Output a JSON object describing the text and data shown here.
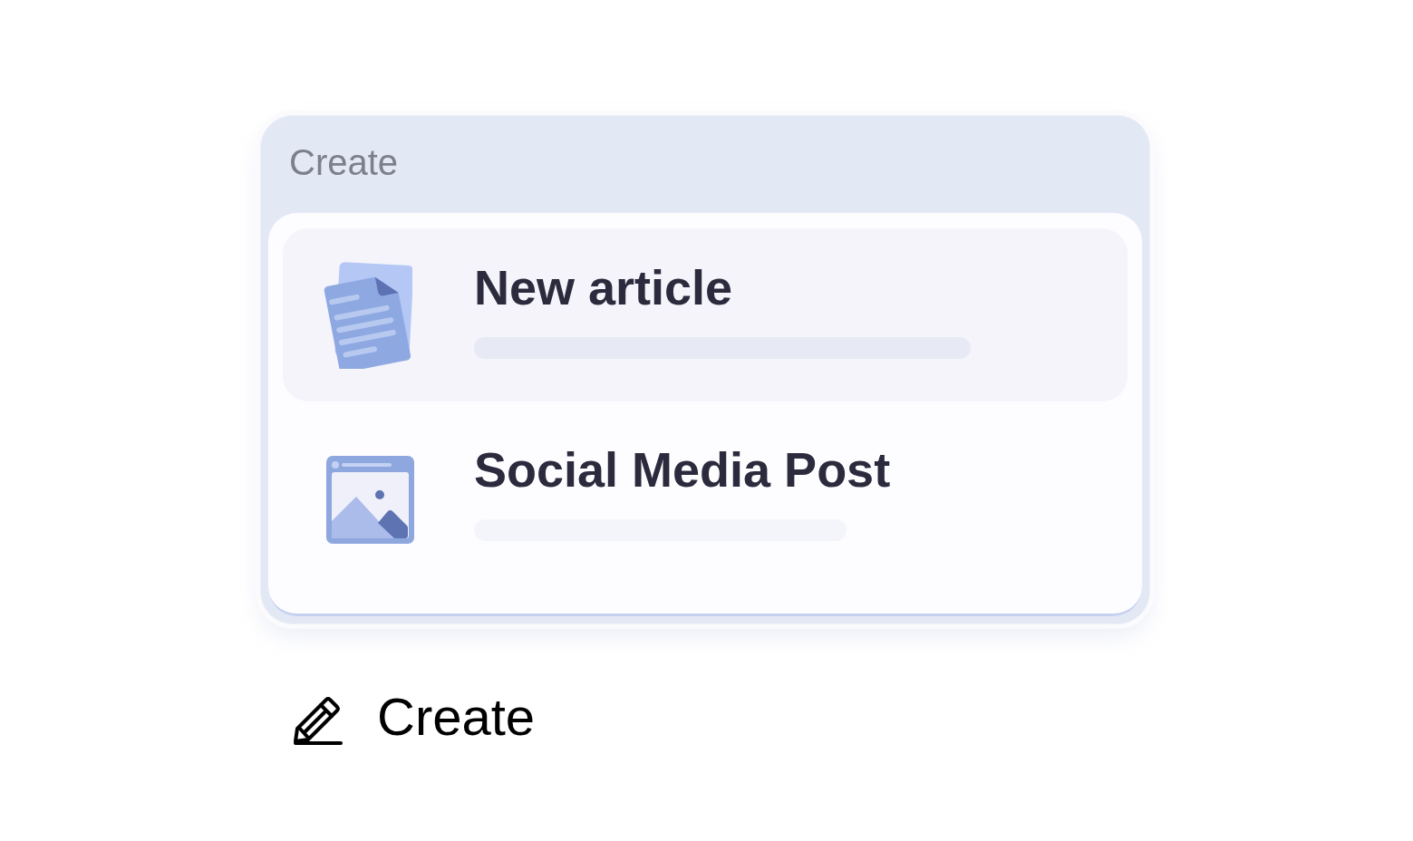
{
  "menu": {
    "header": "Create",
    "items": [
      {
        "label": "New article",
        "kind": "article",
        "selected": true
      },
      {
        "label": "Social Media Post",
        "kind": "image",
        "selected": false
      }
    ]
  },
  "action": {
    "label": "Create"
  }
}
